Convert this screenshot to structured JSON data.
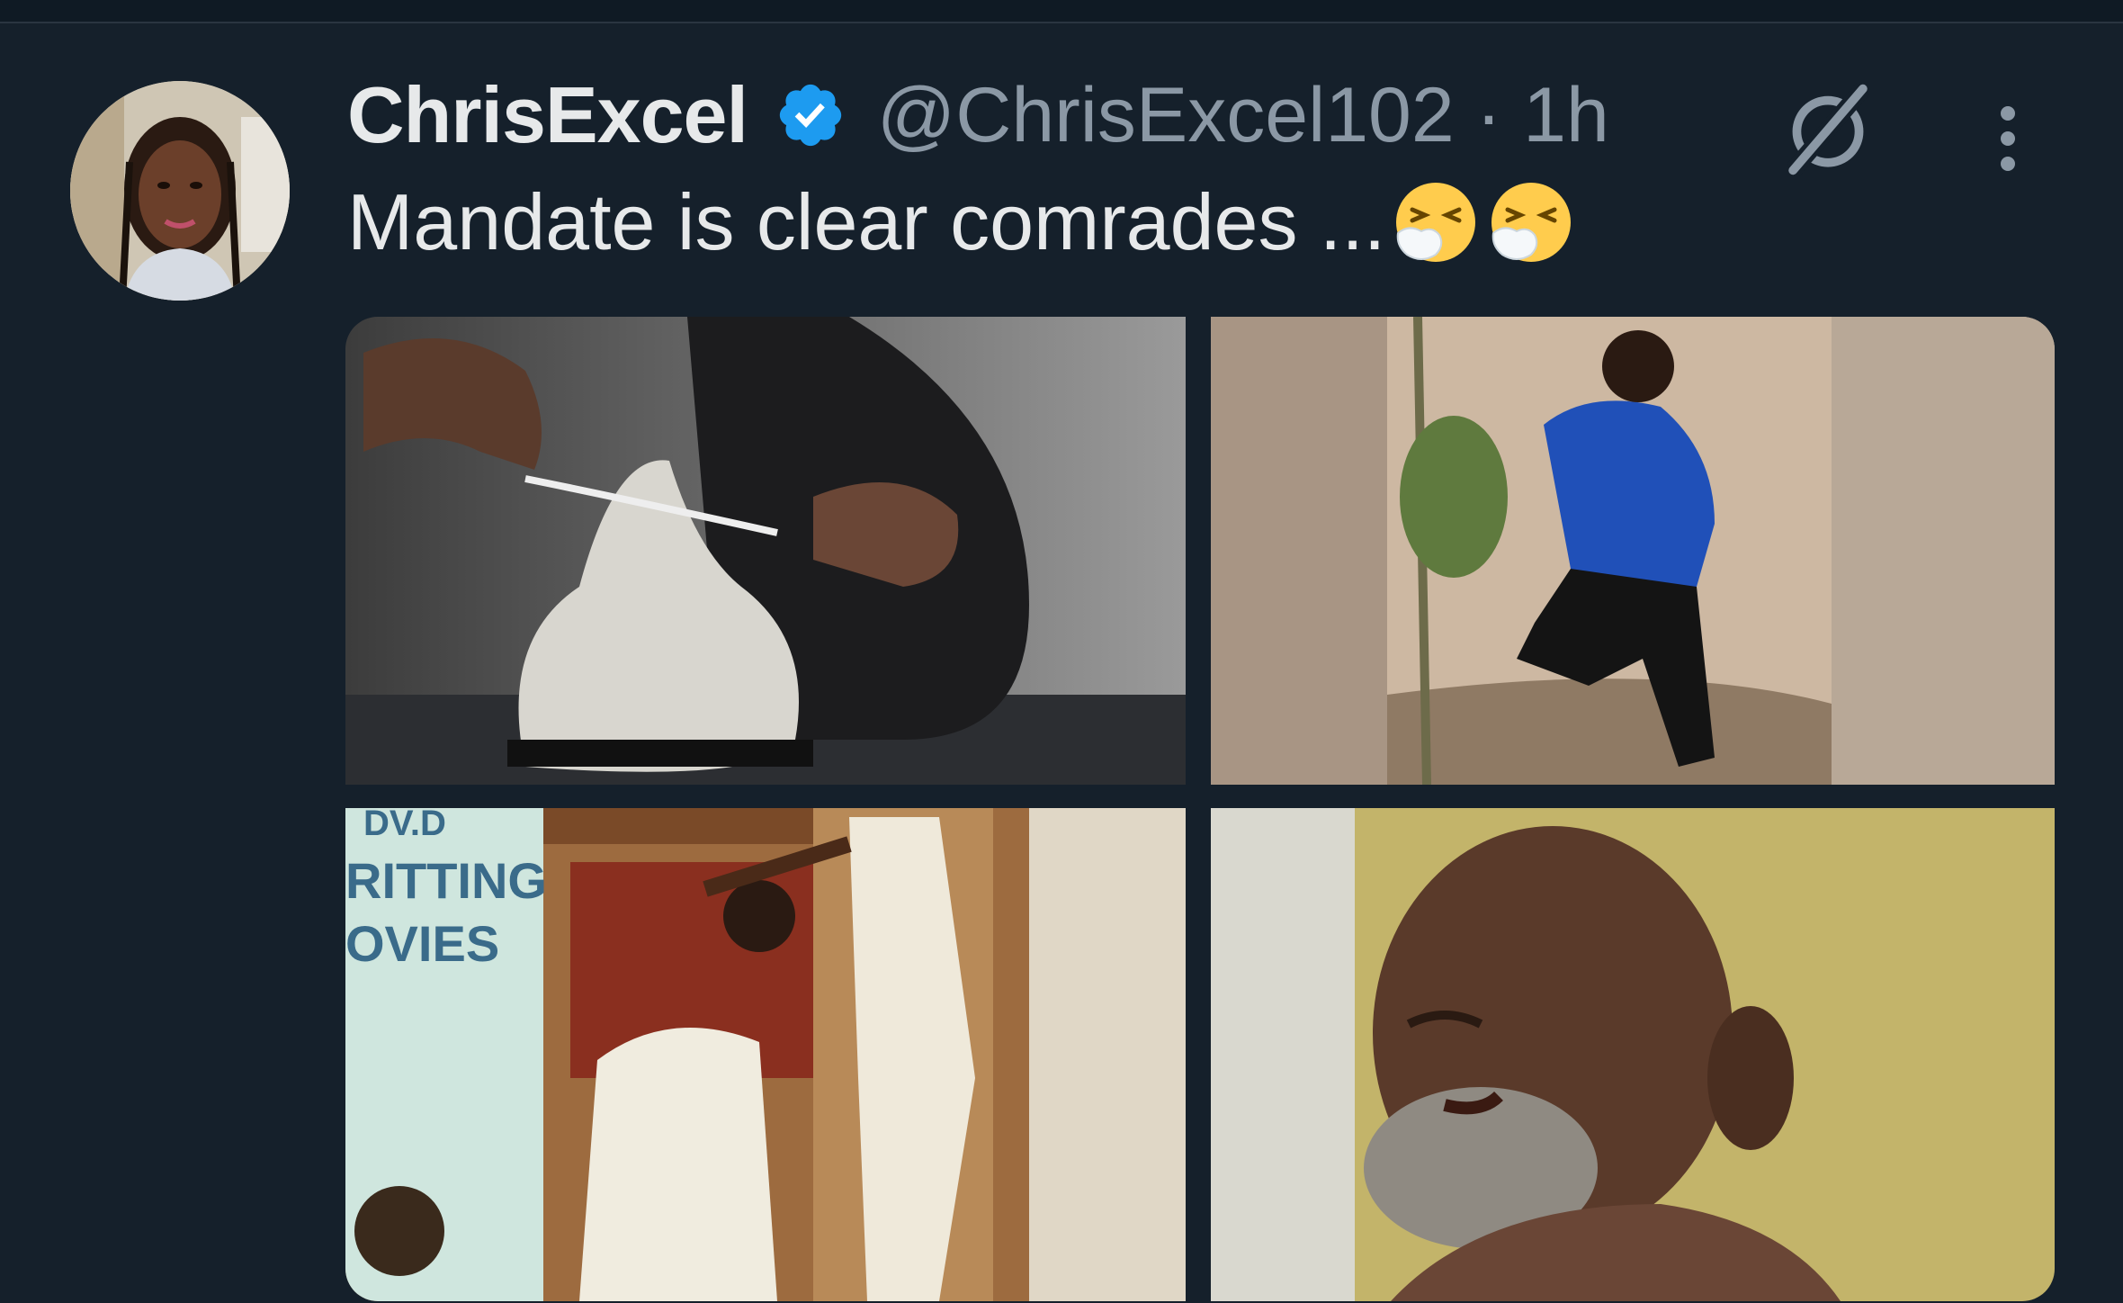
{
  "tweet": {
    "author": {
      "name": "ChrisExcel",
      "handle": "@ChrisExcel102",
      "verified": true
    },
    "separator": "·",
    "time": "1h",
    "text": "Mandate is clear comrades ...",
    "emojis": [
      "sneezing-face",
      "sneezing-face"
    ],
    "media": [
      {
        "description": "person-tying-sneaker"
      },
      {
        "description": "man-running-between-walls"
      },
      {
        "description": "barber-shop-haircut",
        "sign_lines": [
          "DV.D",
          "RITTING",
          "OVIES"
        ]
      },
      {
        "description": "man-grabbed-by-neck"
      }
    ]
  },
  "colors": {
    "background": "#15202b",
    "text": "#e7e9ea",
    "secondary": "#8b98a5",
    "verified": "#1d9bf0"
  },
  "icons": {
    "grok": "grok-icon",
    "more": "more-options-icon",
    "verified": "verified-badge-icon"
  }
}
